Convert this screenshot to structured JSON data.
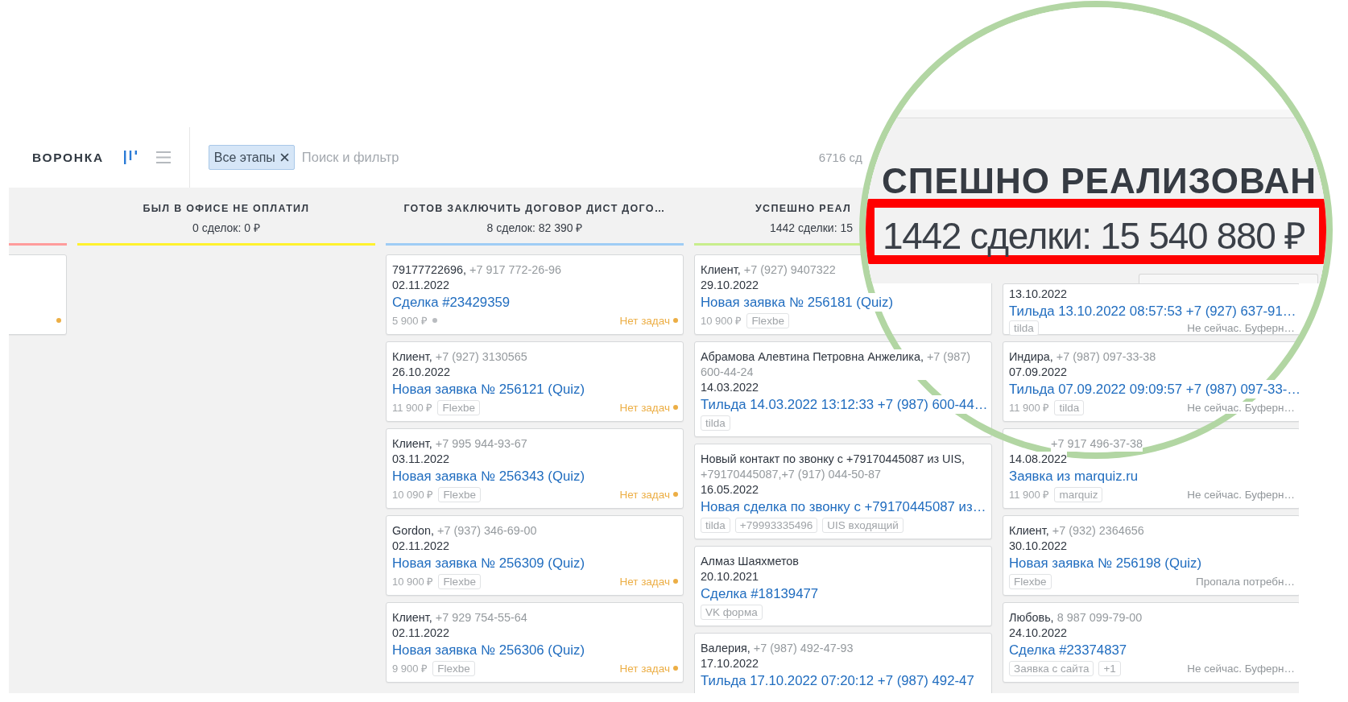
{
  "toolbar": {
    "title": "ВОРОНКА",
    "views": [
      {
        "kind": "board",
        "selected": true
      },
      {
        "kind": "list",
        "selected": false
      }
    ],
    "filter_tag": "Все этапы",
    "search": {
      "placeholder": "Поиск и фильтр"
    },
    "count": "6716 сд"
  },
  "columns": [
    {
      "color": "#ff9c9c",
      "cards": [
        {
          "status": {
            "kind": "no-tasks"
          }
        }
      ]
    },
    {
      "title": "БЫЛ В ОФИСЕ НЕ ОПЛАТИЛ",
      "summary": "0 сделок: 0 ₽",
      "cut": false,
      "color": "#fff22e"
    },
    {
      "title": "ГОТОВ ЗАКЛЮЧИТЬ ДОГОВОР ДИСТ ДОГО…",
      "summary": "8 сделок: 82 390 ₽",
      "cut": false,
      "color": "#9fcdf5",
      "cards": [
        {
          "contact": "79177722696,",
          "phone": "+7 917 772-26-96",
          "date": "02.11.2022",
          "title": "Сделка #23429359",
          "price": "5 900 ₽",
          "price_dot": true,
          "status": {
            "kind": "no-tasks",
            "text": "Нет задач"
          }
        },
        {
          "contact": "Клиент,",
          "phone": "+7 (927) 3130565",
          "date": "26.10.2022",
          "title": "Новая заявка № 256121 (Quiz)",
          "price": "11 900 ₽",
          "price_dot": false,
          "tags": [
            "Flexbe"
          ],
          "status": {
            "kind": "no-tasks",
            "text": "Нет задач"
          }
        },
        {
          "contact": "Клиент,",
          "phone": "+7 995 944-93-67",
          "date": "03.11.2022",
          "title": "Новая заявка № 256343 (Quiz)",
          "price": "10 090 ₽",
          "price_dot": false,
          "tags": [
            "Flexbe"
          ],
          "status": {
            "kind": "no-tasks",
            "text": "Нет задач"
          }
        },
        {
          "contact": "Gordon,",
          "phone": "+7 (937) 346-69-00",
          "date": "02.11.2022",
          "title": "Новая заявка № 256309 (Quiz)",
          "price": "10 900 ₽",
          "price_dot": false,
          "tags": [
            "Flexbe"
          ],
          "status": {
            "kind": "no-tasks",
            "text": "Нет задач"
          }
        },
        {
          "contact": "Клиент,",
          "phone": "+7 929 754-55-64",
          "date": "02.11.2022",
          "title": "Новая заявка № 256306 (Quiz)",
          "price": "9 900 ₽",
          "price_dot": false,
          "tags": [
            "Flexbe"
          ],
          "status": {
            "kind": "no-tasks",
            "text": "Нет задач"
          }
        }
      ]
    },
    {
      "title": "УСПЕШНО РЕАЛ",
      "summary": "1442 сделки: 15",
      "cut": true,
      "color": "#c8ee8c",
      "cards": [
        {
          "contact": "Клиент,",
          "phone": "+7 (927) 9407322",
          "date": "29.10.2022",
          "title": "Новая заявка № 256181 (Quiz)",
          "price": "10 900 ₽",
          "tags": [
            "Flexbe"
          ]
        },
        {
          "contact": "Абрамова Алевтина Петровна Анжелика,",
          "phone": "+7 (987) 600-44-24",
          "date": "14.03.2022",
          "title": "Тильда 14.03.2022 13:12:33 +7 (987) 600-44…",
          "tags": [
            "tilda"
          ]
        },
        {
          "contact": "Новый контакт по звонку с +79170445087 из UIS,",
          "phone": "+79170445087,+7 (917) 044-50-87",
          "date": "16.05.2022",
          "title": "Новая сделка по звонку с +79170445087 из…",
          "tags": [
            "tilda",
            "+79993335496",
            "UIS входящий"
          ]
        },
        {
          "contact": "Алмаз Шаяхметов",
          "date": "20.10.2021",
          "title": "Сделка #18139477",
          "tags": [
            "VK форма"
          ]
        },
        {
          "contact": "Валерия,",
          "phone": "+7 (987) 492-47-93",
          "date": "17.10.2022",
          "title": "Тильда 17.10.2022 07:20:12 +7 (987) 492-47"
        }
      ]
    },
    {
      "cards": [
        {
          "date": "13.10.2022",
          "title": "Тильда 13.10.2022 08:57:53 +7 (927) 637-91…",
          "tags": [
            "tilda"
          ],
          "status": {
            "kind": "stage",
            "text": "Не сейчас. Буферн…"
          }
        },
        {
          "contact": "Индира,",
          "phone": "+7 (987) 097-33-38",
          "date": "07.09.2022",
          "title": "Тильда 07.09.2022 09:09:57 +7 (987) 097-33-…",
          "price": "11 900 ₽",
          "tags": [
            "tilda"
          ],
          "status": {
            "kind": "stage",
            "text": "Не сейчас. Буферн…"
          }
        },
        {
          "phone": "+7 917 496-37-38",
          "date": "14.08.2022",
          "title": "Заявка из marquiz.ru",
          "price": "11 900 ₽",
          "tags": [
            "marquiz"
          ],
          "status": {
            "kind": "stage",
            "text": "Не сейчас. Буферн…"
          }
        },
        {
          "contact": "Клиент,",
          "phone": "+7 (932) 2364656",
          "date": "30.10.2022",
          "title": "Новая заявка № 256198 (Quiz)",
          "tags": [
            "Flexbe"
          ],
          "status": {
            "kind": "stage",
            "text": "Пропала потребн…"
          }
        },
        {
          "contact": "Любовь,",
          "phone": "8 987 099-79-00",
          "date": "24.10.2022",
          "title": "Сделка #23374837",
          "tags": [
            "Заявка с сайта",
            "+1"
          ],
          "status": {
            "kind": "stage",
            "text": "Не сейчас. Буферн…"
          }
        }
      ]
    }
  ],
  "magnifier": {
    "title": "СПЕШНО РЕАЛИЗОВАН",
    "summary": "1442 сделки: 15 540 880 ₽"
  }
}
